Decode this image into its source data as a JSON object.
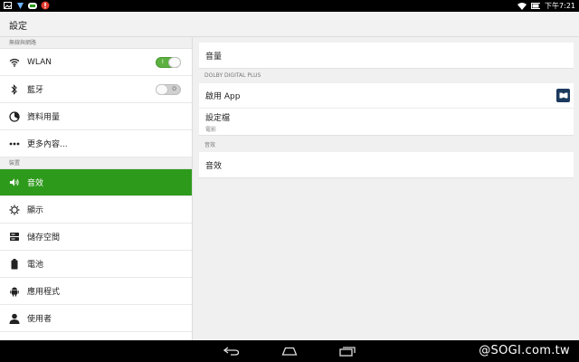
{
  "status_bar": {
    "time": "下午7:21"
  },
  "header": {
    "title": "設定"
  },
  "sidebar": {
    "sections": [
      {
        "header": "無線與網路",
        "items": [
          {
            "label": "WLAN",
            "icon": "wifi-icon",
            "toggle": "on",
            "toggle_text": "I"
          },
          {
            "label": "藍牙",
            "icon": "bluetooth-icon",
            "toggle": "off",
            "toggle_text": "O"
          },
          {
            "label": "資料用量",
            "icon": "data-usage-icon"
          },
          {
            "label": "更多內容...",
            "icon": "more-icon"
          }
        ]
      },
      {
        "header": "裝置",
        "items": [
          {
            "label": "音效",
            "icon": "volume-icon",
            "active": true
          },
          {
            "label": "顯示",
            "icon": "brightness-icon"
          },
          {
            "label": "儲存空間",
            "icon": "storage-icon"
          },
          {
            "label": "電池",
            "icon": "battery-icon"
          },
          {
            "label": "應用程式",
            "icon": "android-icon"
          },
          {
            "label": "使用者",
            "icon": "user-icon"
          }
        ]
      }
    ]
  },
  "main": {
    "volume": "音量",
    "dolby_header": "DOLBY DIGITAL PLUS",
    "enable_app": "啟用 App",
    "profile": "設定檔",
    "profile_value": "電影",
    "sound_header": "音效",
    "sound_effects": "音效"
  },
  "watermark": "@SOGI.com.tw",
  "colors": {
    "accent": "#2e9a1c",
    "dolby": "#1b3a5e"
  }
}
